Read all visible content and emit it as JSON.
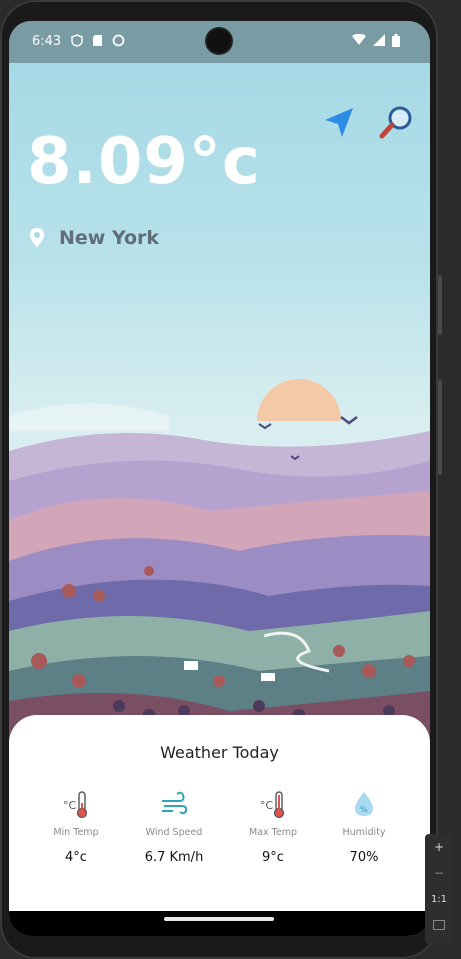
{
  "status": {
    "time": "6:43"
  },
  "weather": {
    "temperature": "8.09°c",
    "city": "New York"
  },
  "card": {
    "title": "Weather Today",
    "stats": [
      {
        "icon": "thermometer-low-icon",
        "label": "Min Temp",
        "value": "4°c"
      },
      {
        "icon": "wind-icon",
        "label": "Wind Speed",
        "value": "6.7 Km/h"
      },
      {
        "icon": "thermometer-high-icon",
        "label": "Max Temp",
        "value": "9°c"
      },
      {
        "icon": "humidity-drop-icon",
        "label": "Humidity",
        "value": "70%"
      }
    ]
  },
  "emulator": {
    "zoom_label": "1:1"
  },
  "colors": {
    "accent": "#2f8be8",
    "city": "#5f6e78",
    "sky": "#a6d9e6"
  }
}
